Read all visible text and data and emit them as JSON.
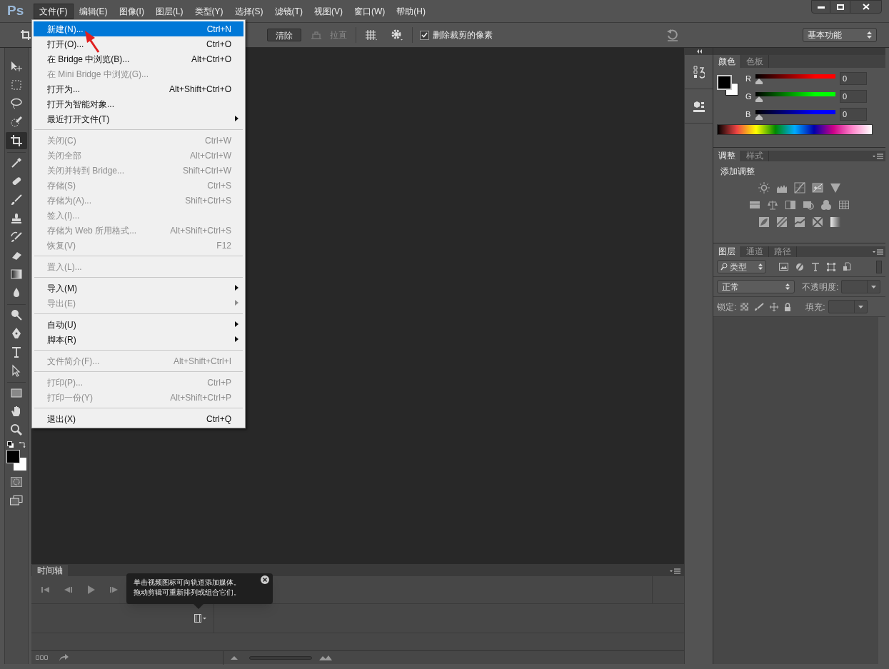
{
  "app": {
    "logo": "Ps"
  },
  "menu_bar": [
    {
      "label": "文件(F)",
      "selected": true
    },
    {
      "label": "编辑(E)",
      "selected": false
    },
    {
      "label": "图像(I)",
      "selected": false
    },
    {
      "label": "图层(L)",
      "selected": false
    },
    {
      "label": "类型(Y)",
      "selected": false
    },
    {
      "label": "选择(S)",
      "selected": false
    },
    {
      "label": "滤镜(T)",
      "selected": false
    },
    {
      "label": "视图(V)",
      "selected": false
    },
    {
      "label": "窗口(W)",
      "selected": false
    },
    {
      "label": "帮助(H)",
      "selected": false
    }
  ],
  "options_bar": {
    "clear_button": "清除",
    "straighten": "拉直",
    "delete_cropped": {
      "label": "删除裁剪的像素",
      "checked": true
    },
    "workspace": "基本功能"
  },
  "tools": [
    {
      "kind": "move",
      "selected": false
    },
    {
      "kind": "marquee",
      "selected": false
    },
    {
      "kind": "lasso",
      "selected": false
    },
    {
      "kind": "quick-select",
      "selected": false
    },
    {
      "kind": "crop",
      "selected": true
    },
    {
      "kind": "eyedropper",
      "selected": false
    },
    {
      "kind": "bandage",
      "selected": false
    },
    {
      "kind": "brush",
      "selected": false
    },
    {
      "kind": "stamp",
      "selected": false
    },
    {
      "kind": "history-brush",
      "selected": false
    },
    {
      "kind": "eraser",
      "selected": false
    },
    {
      "kind": "gradient",
      "selected": false
    },
    {
      "kind": "drop",
      "selected": false
    },
    {
      "kind": "dodge",
      "selected": false
    },
    {
      "kind": "pen",
      "selected": false
    },
    {
      "kind": "type",
      "selected": false
    },
    {
      "kind": "path-select",
      "selected": false
    },
    {
      "kind": "rectangle",
      "selected": false
    },
    {
      "kind": "hand",
      "selected": false
    },
    {
      "kind": "zoom",
      "selected": false
    }
  ],
  "file_menu": [
    {
      "kind": "item",
      "label": "新建(N)...",
      "shortcut": "Ctrl+N",
      "disabled": false,
      "submenu": false,
      "highlighted": true
    },
    {
      "kind": "item",
      "label": "打开(O)...",
      "shortcut": "Ctrl+O",
      "disabled": false,
      "submenu": false,
      "highlighted": false
    },
    {
      "kind": "item",
      "label": "在 Bridge 中浏览(B)...",
      "shortcut": "Alt+Ctrl+O",
      "disabled": false,
      "submenu": false,
      "highlighted": false
    },
    {
      "kind": "item",
      "label": "在 Mini Bridge 中浏览(G)...",
      "disabled": true,
      "submenu": false,
      "highlighted": false
    },
    {
      "kind": "item",
      "label": "打开为...",
      "shortcut": "Alt+Shift+Ctrl+O",
      "disabled": false,
      "submenu": false,
      "highlighted": false
    },
    {
      "kind": "item",
      "label": "打开为智能对象...",
      "disabled": false,
      "submenu": false,
      "highlighted": false
    },
    {
      "kind": "item",
      "label": "最近打开文件(T)",
      "disabled": false,
      "submenu": true,
      "highlighted": false
    },
    {
      "kind": "separator"
    },
    {
      "kind": "item",
      "label": "关闭(C)",
      "shortcut": "Ctrl+W",
      "disabled": true,
      "submenu": false,
      "highlighted": false
    },
    {
      "kind": "item",
      "label": "关闭全部",
      "shortcut": "Alt+Ctrl+W",
      "disabled": true,
      "submenu": false,
      "highlighted": false
    },
    {
      "kind": "item",
      "label": "关闭并转到 Bridge...",
      "shortcut": "Shift+Ctrl+W",
      "disabled": true,
      "submenu": false,
      "highlighted": false
    },
    {
      "kind": "item",
      "label": "存储(S)",
      "shortcut": "Ctrl+S",
      "disabled": true,
      "submenu": false,
      "highlighted": false
    },
    {
      "kind": "item",
      "label": "存储为(A)...",
      "shortcut": "Shift+Ctrl+S",
      "disabled": true,
      "submenu": false,
      "highlighted": false
    },
    {
      "kind": "item",
      "label": "签入(I)...",
      "disabled": true,
      "submenu": false,
      "highlighted": false
    },
    {
      "kind": "item",
      "label": "存储为 Web 所用格式...",
      "shortcut": "Alt+Shift+Ctrl+S",
      "disabled": true,
      "submenu": false,
      "highlighted": false
    },
    {
      "kind": "item",
      "label": "恢复(V)",
      "shortcut": "F12",
      "disabled": true,
      "submenu": false,
      "highlighted": false
    },
    {
      "kind": "separator"
    },
    {
      "kind": "item",
      "label": "置入(L)...",
      "disabled": true,
      "submenu": false,
      "highlighted": false
    },
    {
      "kind": "separator"
    },
    {
      "kind": "item",
      "label": "导入(M)",
      "disabled": false,
      "submenu": true,
      "highlighted": false
    },
    {
      "kind": "item",
      "label": "导出(E)",
      "disabled": true,
      "submenu": true,
      "highlighted": false
    },
    {
      "kind": "separator"
    },
    {
      "kind": "item",
      "label": "自动(U)",
      "disabled": false,
      "submenu": true,
      "highlighted": false
    },
    {
      "kind": "item",
      "label": "脚本(R)",
      "disabled": false,
      "submenu": true,
      "highlighted": false
    },
    {
      "kind": "separator"
    },
    {
      "kind": "item",
      "label": "文件简介(F)...",
      "shortcut": "Alt+Shift+Ctrl+I",
      "disabled": true,
      "submenu": false,
      "highlighted": false
    },
    {
      "kind": "separator"
    },
    {
      "kind": "item",
      "label": "打印(P)...",
      "shortcut": "Ctrl+P",
      "disabled": true,
      "submenu": false,
      "highlighted": false
    },
    {
      "kind": "item",
      "label": "打印一份(Y)",
      "shortcut": "Alt+Shift+Ctrl+P",
      "disabled": true,
      "submenu": false,
      "highlighted": false
    },
    {
      "kind": "separator"
    },
    {
      "kind": "item",
      "label": "退出(X)",
      "shortcut": "Ctrl+Q",
      "disabled": false,
      "submenu": false,
      "highlighted": false
    }
  ],
  "color_panel": {
    "tabs": [
      {
        "label": "颜色",
        "selected": true
      },
      {
        "label": "色板",
        "selected": false
      }
    ],
    "channels": [
      {
        "label": "R",
        "value": "0",
        "level": 0,
        "color": "#ff0000"
      },
      {
        "label": "G",
        "value": "0",
        "level": 0,
        "color": "#00ff00"
      },
      {
        "label": "B",
        "value": "0",
        "level": 0,
        "color": "#0000ff"
      }
    ]
  },
  "adjustments_panel": {
    "tabs": [
      {
        "label": "调整",
        "selected": true
      },
      {
        "label": "样式",
        "selected": false
      }
    ],
    "title": "添加调整"
  },
  "layers_panel": {
    "tabs": [
      {
        "label": "图层",
        "selected": true
      },
      {
        "label": "通道",
        "selected": false
      },
      {
        "label": "路径",
        "selected": false
      }
    ],
    "filter": "类型",
    "blend_mode": "正常",
    "opacity_label": "不透明度:",
    "lock_label": "锁定:",
    "fill_label": "填充:"
  },
  "timeline": {
    "tab": "时间轴",
    "zoom_slider": {
      "level": 0
    },
    "tooltip": [
      "单击视频图标可向轨道添加媒体。",
      "拖动剪辑可重新排列或组合它们。"
    ]
  }
}
